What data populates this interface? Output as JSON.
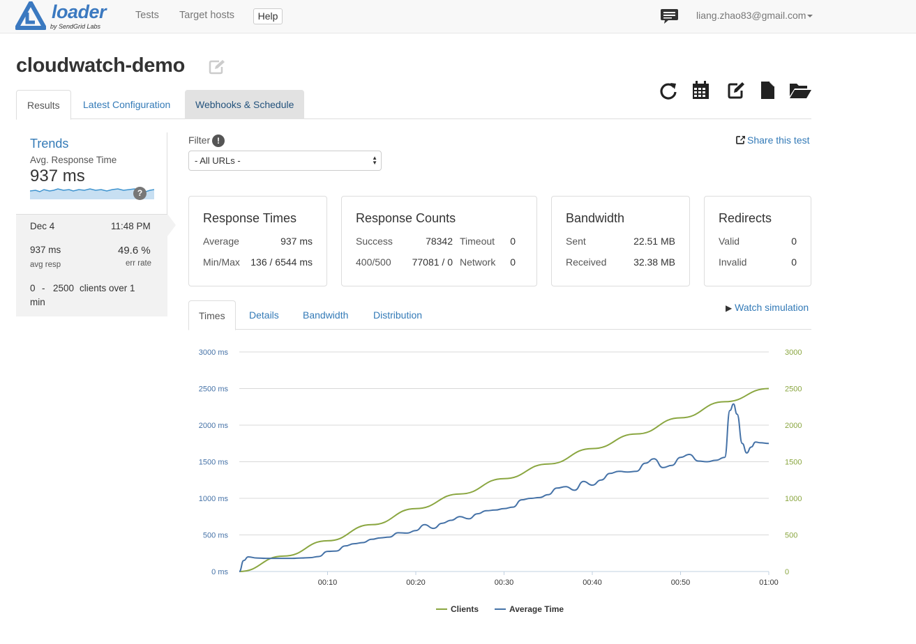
{
  "nav": {
    "brand": "loader",
    "brand_sub": "by SendGrid Labs",
    "items": [
      "Tests",
      "Target hosts"
    ],
    "help": "Help",
    "user": "liang.zhao83@gmail.com"
  },
  "page": {
    "title": "cloudwatch-demo"
  },
  "toolbar_icons": [
    "refresh-icon",
    "calendar-icon",
    "edit-icon",
    "file-icon",
    "folder-open-icon"
  ],
  "tabs": [
    {
      "label": "Results",
      "active": true
    },
    {
      "label": "Latest Configuration"
    },
    {
      "label": "Webhooks & Schedule"
    }
  ],
  "sidebar": {
    "trends": "Trends",
    "avg_label": "Avg. Response Time",
    "avg_value": "937 ms",
    "help": "?",
    "date": "Dec 4",
    "time": "11:48 PM",
    "resp": "937 ms",
    "resp_label": "avg resp",
    "err": "49.6 %",
    "err_label": "err rate",
    "clients_from": "0",
    "clients_dash": "-",
    "clients_to": "2500",
    "clients_text": "clients over 1",
    "clients_text2": "min"
  },
  "filter": {
    "label": "Filter",
    "info": "!",
    "selected": "- All URLs -",
    "share": "Share this test"
  },
  "cards": {
    "response_times": {
      "title": "Response Times",
      "average_label": "Average",
      "average": "937 ms",
      "minmax_label": "Min/Max",
      "minmax": "136 / 6544 ms"
    },
    "response_counts": {
      "title": "Response Counts",
      "success_label": "Success",
      "success": "78342",
      "timeout_label": "Timeout",
      "timeout": "0",
      "err_label": "400/500",
      "err": "77081 / 0",
      "network_label": "Network",
      "network": "0"
    },
    "bandwidth": {
      "title": "Bandwidth",
      "sent_label": "Sent",
      "sent": "22.51 MB",
      "received_label": "Received",
      "received": "32.38 MB"
    },
    "redirects": {
      "title": "Redirects",
      "valid_label": "Valid",
      "valid": "0",
      "invalid_label": "Invalid",
      "invalid": "0"
    }
  },
  "chart_tabs": [
    {
      "label": "Times",
      "active": true
    },
    {
      "label": "Details"
    },
    {
      "label": "Bandwidth"
    },
    {
      "label": "Distribution"
    }
  ],
  "watch": "Watch simulation",
  "colors": {
    "clients": "#8aa640",
    "avg_time": "#4572a7",
    "link": "#337ab7"
  },
  "chart_data": {
    "type": "line",
    "x_ticks": [
      "00:10",
      "00:20",
      "00:30",
      "00:40",
      "00:50",
      "01:00"
    ],
    "x_tick_seconds": [
      10,
      20,
      30,
      40,
      50,
      60
    ],
    "xlim": [
      0,
      60
    ],
    "y_left_ticks": [
      "0 ms",
      "500 ms",
      "1000 ms",
      "1500 ms",
      "2000 ms",
      "2500 ms",
      "3000 ms"
    ],
    "y_right_ticks": [
      "0",
      "500",
      "1000",
      "1500",
      "2000",
      "2500",
      "3000"
    ],
    "ylim": [
      0,
      3000
    ],
    "grid": true,
    "legend": "bottom",
    "series": [
      {
        "name": "Clients",
        "axis": "right",
        "x": [
          0,
          5,
          10,
          15,
          20,
          25,
          30,
          35,
          40,
          45,
          50,
          55,
          60
        ],
        "values": [
          0,
          210,
          420,
          640,
          860,
          1060,
          1270,
          1470,
          1680,
          1880,
          2100,
          2320,
          2500
        ]
      },
      {
        "name": "Average Time",
        "axis": "left",
        "x": [
          0,
          0.5,
          1,
          2,
          3,
          4,
          5,
          6,
          7,
          8,
          9,
          10,
          11,
          12,
          13,
          14,
          15,
          16,
          17,
          18,
          19,
          20,
          21,
          22,
          23,
          24,
          25,
          26,
          27,
          28,
          29,
          30,
          31,
          32,
          33,
          34,
          35,
          36,
          37,
          38,
          39,
          40,
          41,
          42,
          43,
          44,
          45,
          46,
          47,
          48,
          49,
          50,
          51,
          52,
          53,
          54,
          55,
          55.6,
          56,
          56.4,
          57,
          57.5,
          58,
          58.5,
          59,
          60
        ],
        "values": [
          0,
          150,
          200,
          185,
          180,
          180,
          180,
          180,
          185,
          190,
          205,
          275,
          280,
          350,
          380,
          395,
          440,
          460,
          470,
          530,
          525,
          560,
          640,
          590,
          660,
          700,
          750,
          720,
          790,
          830,
          840,
          860,
          880,
          980,
          1000,
          1010,
          1050,
          1140,
          1160,
          1110,
          1230,
          1180,
          1250,
          1340,
          1370,
          1360,
          1370,
          1480,
          1540,
          1420,
          1450,
          1560,
          1600,
          1510,
          1500,
          1520,
          1560,
          2200,
          2290,
          2150,
          1750,
          1620,
          1700,
          1770,
          1760,
          1750
        ]
      }
    ]
  }
}
